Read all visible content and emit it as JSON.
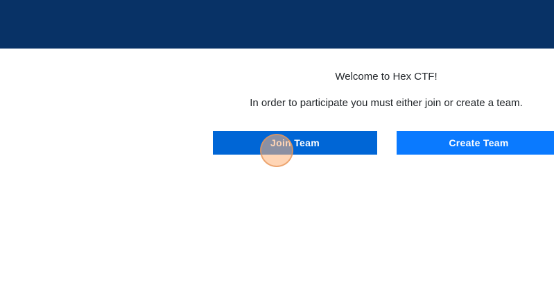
{
  "content": {
    "welcome_text": "Welcome to Hex CTF!",
    "instruction_text": "In order to participate you must either join or create a team."
  },
  "actions": {
    "join_team_label": "Join Team",
    "create_team_label": "Create Team"
  },
  "colors": {
    "banner": "#083266",
    "join_button": "#0066d6",
    "create_button": "#0a7aff"
  }
}
